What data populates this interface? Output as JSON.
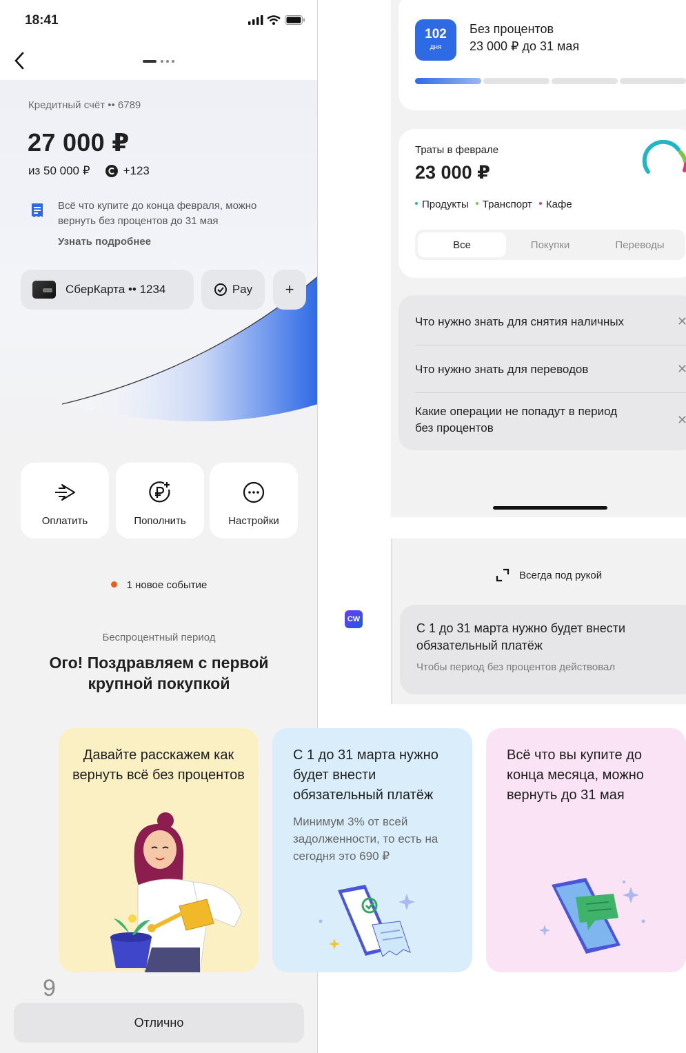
{
  "status": {
    "time": "18:41"
  },
  "account": {
    "label": "Кредитный счёт •• 6789",
    "amount": "27 000 ₽",
    "limit": "из 50 000 ₽",
    "bonus": "+123",
    "info": "Всё что купите до конца февраля, можно вернуть без процентов до 31 мая",
    "info_link": "Узнать подробнее",
    "card_label": "СберКарта •• 1234",
    "pay_label": "Pay",
    "add_label": "+"
  },
  "actions": [
    {
      "label": "Оплатить",
      "icon": "send-icon"
    },
    {
      "label": "Пополнить",
      "icon": "ruble-plus-icon"
    },
    {
      "label": "Настройки",
      "icon": "more-icon"
    }
  ],
  "event": "1 новое событие",
  "period_label": "Беспроцентный период",
  "congrats": "Ого! Поздравляем с первой крупной покупкой",
  "page_counter": "9",
  "ok_button": "Отлично",
  "grace": {
    "days": "102",
    "days_unit": "дня",
    "title": "Без процентов",
    "subtitle": "23 000 ₽ до 31 мая",
    "progress_segments_filled": 1,
    "progress_segments_total": 4
  },
  "spending": {
    "label": "Траты в феврале",
    "amount": "23 000 ₽",
    "categories": [
      {
        "name": "Продукты",
        "color": "#21b6c7"
      },
      {
        "name": "Транспорт",
        "color": "#7ac943"
      },
      {
        "name": "Кафе",
        "color": "#e5337a"
      }
    ],
    "tabs": [
      "Все",
      "Покупки",
      "Переводы"
    ],
    "active_tab": "Все"
  },
  "faq": [
    "Что нужно знать для снятия наличных",
    "Что нужно знать для переводов",
    "Какие операции не попадут в период без процентов"
  ],
  "cw_badge": "CW",
  "handy": "Всегда под рукой",
  "payment_card": {
    "title": "С 1 до 31 марта нужно будет внести обязательный платёж",
    "subtitle": "Чтобы период без процентов действовал"
  },
  "stories": [
    {
      "title": "Давайте расскажем как вернуть всё без процентов",
      "subtitle": "",
      "color": "#fbf0c4"
    },
    {
      "title": "С 1 до 31 марта нужно будет внести обязательный платёж",
      "subtitle": "Минимум 3% от всей задолженности, то есть на сегодня это 690 ₽",
      "color": "#d9eefa"
    },
    {
      "title": "Всё что вы купите до конца месяца, можно вернуть до 31 мая",
      "subtitle": "",
      "color": "#f9e3f5"
    }
  ],
  "colors": {
    "accent": "#2f6ae5",
    "event_dot": "#ee5a1e"
  }
}
